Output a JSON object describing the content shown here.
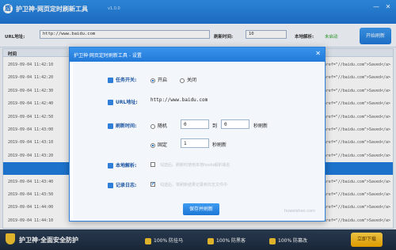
{
  "app": {
    "title": "护卫神·网页定时刷新工具",
    "version": "v1.0.0",
    "minimize": "—",
    "close": "✕"
  },
  "toolbar": {
    "url_label": "URL地址:",
    "url_value": "http://www.baidu.com",
    "interval_label": "刷新时间:",
    "interval_value": "10",
    "status_label": "本地解析:",
    "status_value": "未启动",
    "start_button": "开始刷新"
  },
  "table": {
    "time_header": "时间",
    "rows": [
      {
        "time": "2019-09-04 11:42:10",
        "resp": "<a href=\"//baidu.com\">Saved</a>"
      },
      {
        "time": "2019-09-04 11:42:20",
        "resp": "<a href=\"//baidu.com\">Saved</a>"
      },
      {
        "time": "2019-09-04 11:42:30",
        "resp": "<a href=\"//baidu.com\">Saved</a>"
      },
      {
        "time": "2019-09-04 11:42:40",
        "resp": "<a href=\"//baidu.com\">Saved</a>"
      },
      {
        "time": "2019-09-04 11:42:50",
        "resp": "<a href=\"//baidu.com\">Saved</a>"
      },
      {
        "time": "2019-09-04 11:43:00",
        "resp": "<a href=\"//baidu.com\">Saved</a>"
      },
      {
        "time": "2019-09-04 11:43:10",
        "resp": "<a href=\"//baidu.com\">Saved</a>"
      },
      {
        "time": "2019-09-04 11:43:20",
        "resp": "<a href=\"//baidu.com\">Saved</a>"
      },
      {
        "time": "",
        "resp": ""
      },
      {
        "time": "2019-09-04 11:43:40",
        "resp": "<a href=\"//baidu.com\">Saved</a>"
      },
      {
        "time": "2019-09-04 11:43:50",
        "resp": "<a href=\"//baidu.com\">Saved</a>"
      },
      {
        "time": "2019-09-04 11:44:00",
        "resp": "<a href=\"//baidu.com\">Saved</a>"
      },
      {
        "time": "2019-09-04 11:44:10",
        "resp": "<a href=\"//baidu.com\">Saved</a>"
      }
    ]
  },
  "dialog": {
    "title": "护卫神·网页定时刷新工具 - 设置",
    "close": "✕",
    "task_label": "任务开关:",
    "task_on": "开启",
    "task_off": "关闭",
    "url_label": "URL地址:",
    "url_value": "http://www.baidu.com",
    "refresh_label": "刷新时间:",
    "random_label": "随机",
    "random_min": "0",
    "to_text": "到",
    "random_max": "0",
    "sec_text_1": "秒刷新",
    "fixed_label": "固定",
    "fixed_value": "1",
    "sec_text_2": "秒刷新",
    "local_label": "本地解析:",
    "local_hint": "勾选后，刷新时使用本地hosts解析域名",
    "log_label": "记录日志:",
    "log_hint": "勾选后，将刷新结果记录到日志文件中",
    "save_button": "保存并刷新",
    "footer": "huweishen.com"
  },
  "bottom": {
    "slogan": "护卫神·全面安全防护",
    "f1": "100% 防挂马",
    "f2": "100% 防黑客",
    "f3": "100% 防篡改",
    "button": "立即下载"
  },
  "colors": {
    "brand": "#1f74d1",
    "accent": "#f2c230"
  }
}
